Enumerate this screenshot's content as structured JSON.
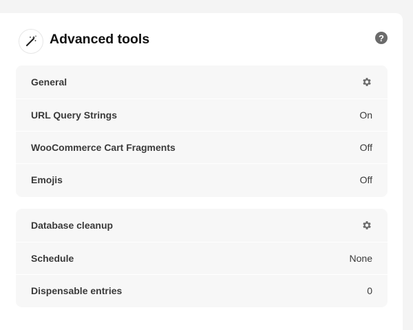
{
  "panel": {
    "title": "Advanced tools",
    "title_icon": "magic-wand-icon",
    "help_icon": "help-icon",
    "help_glyph": "?"
  },
  "groups": [
    {
      "title": "General",
      "settings_icon": "gear-icon",
      "rows": [
        {
          "label": "URL Query Strings",
          "value": "On"
        },
        {
          "label": "WooCommerce Cart Fragments",
          "value": "Off"
        },
        {
          "label": "Emojis",
          "value": "Off"
        }
      ]
    },
    {
      "title": "Database cleanup",
      "settings_icon": "gear-icon",
      "rows": [
        {
          "label": "Schedule",
          "value": "None"
        },
        {
          "label": "Dispensable entries",
          "value": "0"
        }
      ]
    }
  ],
  "colors": {
    "page_bg": "#f4f4f4",
    "panel_bg": "#ffffff",
    "group_bg": "#f7f7f7",
    "text": "#3a3a3a",
    "icon": "#6b6b6b"
  }
}
